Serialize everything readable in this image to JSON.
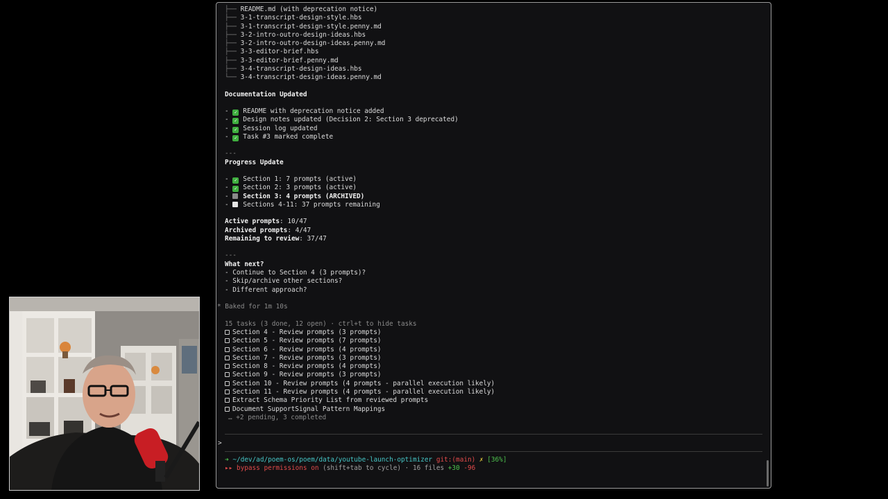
{
  "terminal": {
    "tree_lines": [
      "README.md (with deprecation notice)",
      "3-1-transcript-design-style.hbs",
      "3-1-transcript-design-style.penny.md",
      "3-2-intro-outro-design-ideas.hbs",
      "3-2-intro-outro-design-ideas.penny.md",
      "3-3-editor-brief.hbs",
      "3-3-editor-brief.penny.md",
      "3-4-transcript-design-ideas.hbs",
      "3-4-transcript-design-ideas.penny.md"
    ],
    "doc_heading": "Documentation Updated",
    "doc_items": [
      "README with deprecation notice added",
      "Design notes updated (Decision 2: Section 3 deprecated)",
      "Session log updated",
      "Task #3 marked complete"
    ],
    "separator": "---",
    "progress_heading": "Progress Update",
    "progress_items": [
      "Section 1: 7 prompts (active)",
      "Section 2: 3 prompts (active)",
      "Section 3: 4 prompts (ARCHIVED)",
      "Sections 4-11: 37 prompts remaining"
    ],
    "stats": {
      "active_label": "Active prompts",
      "active_value": ": 10/47",
      "archived_label": "Archived prompts",
      "archived_value": ": 4/47",
      "remaining_label": "Remaining to review",
      "remaining_value": ": 37/47"
    },
    "next_heading": "What next?",
    "next_items": [
      "- Continue to Section 4 (3 prompts)?",
      "- Skip/archive other sections?",
      "- Different approach?"
    ],
    "baked": "* Baked for 1m 10s",
    "tasks_header": "15 tasks (3 done, 12 open) · ctrl+t to hide tasks",
    "tasks": [
      "Section 4 - Review prompts (3 prompts)",
      "Section 5 - Review prompts (7 prompts)",
      "Section 6 - Review prompts (4 prompts)",
      "Section 7 - Review prompts (3 prompts)",
      "Section 8 - Review prompts (4 prompts)",
      "Section 9 - Review prompts (3 prompts)",
      "Section 10 - Review prompts (4 prompts - parallel execution likely)",
      "Section 11 - Review prompts (4 prompts - parallel execution likely)",
      "Extract Schema Priority List from reviewed prompts",
      "Document SupportSignal Pattern Mappings"
    ],
    "tasks_more": "… +2 pending, 3 completed",
    "prompt_symbol": ">",
    "status": {
      "arrow": "➜",
      "path": "~/dev/ad/poem-os/poem/data/youtube-launch-optimizer",
      "git": "git:(main)",
      "dirty": "✗",
      "percent": "[36%]",
      "bypass_icon": "▸▸",
      "bypass": "bypass permissions on",
      "cycle": "(shift+tab to cycle) · 16 files",
      "added": "+30",
      "removed": "-96"
    }
  },
  "colors": {
    "terminal_bg": "#111113",
    "check_green": "#3fae3f",
    "path_cyan": "#46c6c6",
    "git_red": "#e04a4a",
    "percent_green": "#4ec24e"
  }
}
